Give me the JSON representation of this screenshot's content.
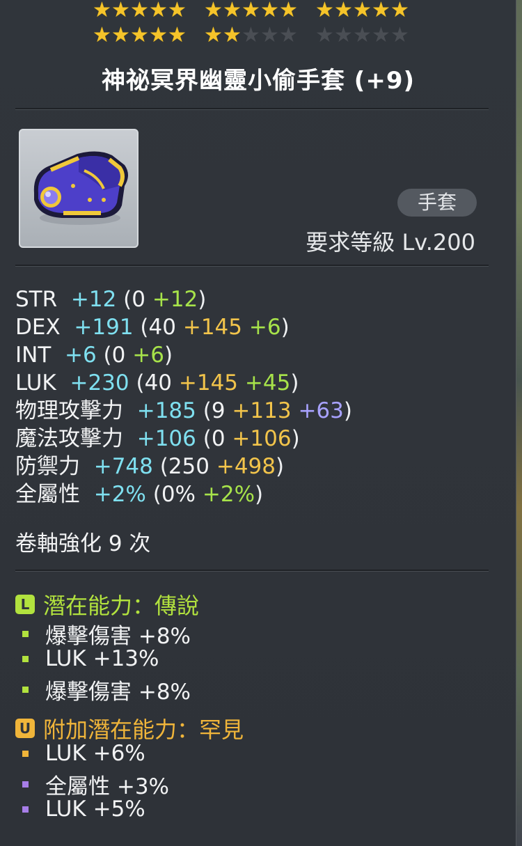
{
  "stars": [
    {
      "on": 5,
      "total": 5
    },
    {
      "on": 5,
      "total": 5
    },
    {
      "on": 5,
      "total": 5
    },
    {
      "on": 5,
      "total": 5
    },
    {
      "on": 2,
      "total": 5
    },
    {
      "on": 0,
      "total": 5
    }
  ],
  "item": {
    "name": "神祕冥界幽靈小偷手套 (+9)",
    "type": "手套",
    "required_level": "要求等級 Lv.200",
    "icon": "purple-gold-glove-icon"
  },
  "stats": [
    {
      "label": "STR",
      "total": "+12",
      "base": "0",
      "bonuses": [
        {
          "v": "+12",
          "c": "b2"
        }
      ]
    },
    {
      "label": "DEX",
      "total": "+191",
      "base": "40",
      "bonuses": [
        {
          "v": "+145",
          "c": "b1"
        },
        {
          "v": "+6",
          "c": "b2"
        }
      ]
    },
    {
      "label": "INT",
      "total": "+6",
      "base": "0",
      "bonuses": [
        {
          "v": "+6",
          "c": "b2"
        }
      ]
    },
    {
      "label": "LUK",
      "total": "+230",
      "base": "40",
      "bonuses": [
        {
          "v": "+145",
          "c": "b1"
        },
        {
          "v": "+45",
          "c": "b2"
        }
      ]
    },
    {
      "label": "物理攻擊力",
      "total": "+185",
      "base": "9",
      "bonuses": [
        {
          "v": "+113",
          "c": "b1"
        },
        {
          "v": "+63",
          "c": "b3"
        }
      ]
    },
    {
      "label": "魔法攻擊力",
      "total": "+106",
      "base": "0",
      "bonuses": [
        {
          "v": "+106",
          "c": "b1"
        }
      ]
    },
    {
      "label": "防禦力",
      "total": "+748",
      "base": "250",
      "bonuses": [
        {
          "v": "+498",
          "c": "b1"
        }
      ]
    },
    {
      "label": "全屬性",
      "total": "+2%",
      "base": "0%",
      "bonuses": [
        {
          "v": "+2%",
          "c": "b2"
        }
      ]
    }
  ],
  "scroll": "卷軸強化 9 次",
  "potential": {
    "badge": "L",
    "title": "潛在能力：傳說",
    "color": "#b2e23e",
    "lines": [
      {
        "text": "爆擊傷害 +8%",
        "color": "#b2e23e"
      },
      {
        "text": "LUK +13%",
        "color": "#b2e23e"
      },
      {
        "text": "爆擊傷害 +8%",
        "color": "#b2e23e"
      }
    ]
  },
  "additional": {
    "badge": "U",
    "title": "附加潛在能力：罕見",
    "color": "#f0b53a",
    "lines": [
      {
        "text": "LUK +6%",
        "color": "#f0b53a"
      },
      {
        "text": "全屬性 +3%",
        "color": "#a77ee8"
      },
      {
        "text": "LUK +5%",
        "color": "#a77ee8"
      }
    ]
  }
}
